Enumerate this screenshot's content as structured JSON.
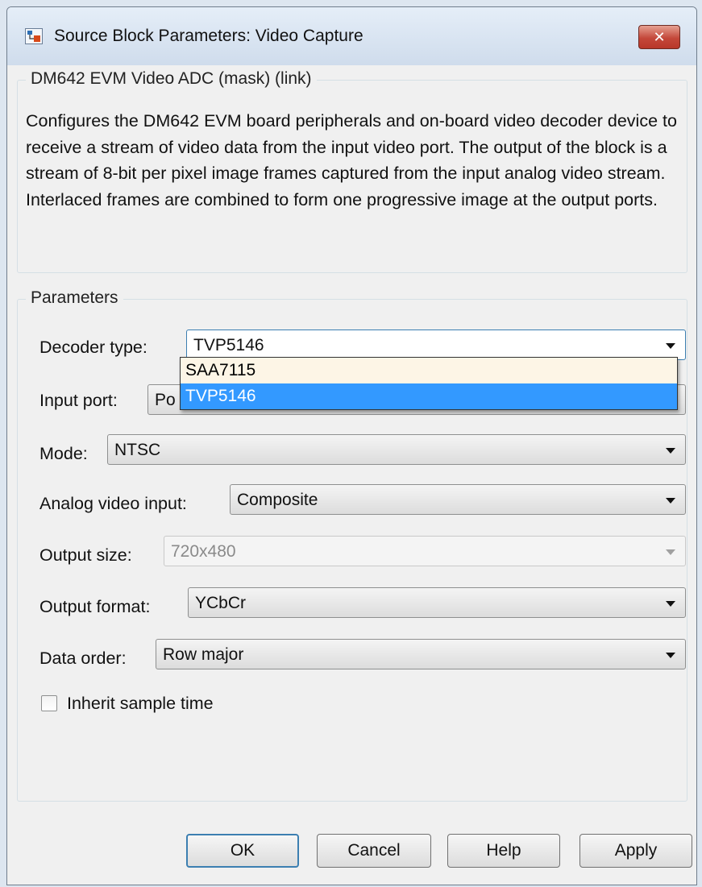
{
  "window": {
    "title": "Source Block Parameters: Video Capture",
    "close_symbol": "✕"
  },
  "description_group": {
    "legend": "DM642 EVM Video ADC (mask) (link)",
    "text": "Configures the DM642 EVM board peripherals and on-board video decoder device to receive a stream of video data from the input video port. The output of the block is a stream of 8-bit per pixel  image frames captured from the input analog video stream. Interlaced frames are combined to form one progressive image at the output ports."
  },
  "parameters_group": {
    "legend": "Parameters",
    "decoder_type": {
      "label": "Decoder type:",
      "value": "TVP5146",
      "options": [
        "SAA7115",
        "TVP5146"
      ],
      "selected_option": "TVP5146"
    },
    "input_port": {
      "label": "Input port:",
      "value": "Po"
    },
    "mode": {
      "label": "Mode:",
      "value": "NTSC"
    },
    "analog_video_input": {
      "label": "Analog video input:",
      "value": "Composite"
    },
    "output_size": {
      "label": "Output size:",
      "value": "720x480",
      "disabled": true
    },
    "output_format": {
      "label": "Output format:",
      "value": "YCbCr"
    },
    "data_order": {
      "label": "Data order:",
      "value": "Row major"
    },
    "inherit_sample_time": {
      "label": "Inherit sample time",
      "checked": false
    }
  },
  "buttons": {
    "ok": "OK",
    "cancel": "Cancel",
    "help": "Help",
    "apply": "Apply"
  },
  "colors": {
    "selection": "#3399ff",
    "focus_border": "#3c7fb1",
    "close_button": "#c4483a"
  }
}
